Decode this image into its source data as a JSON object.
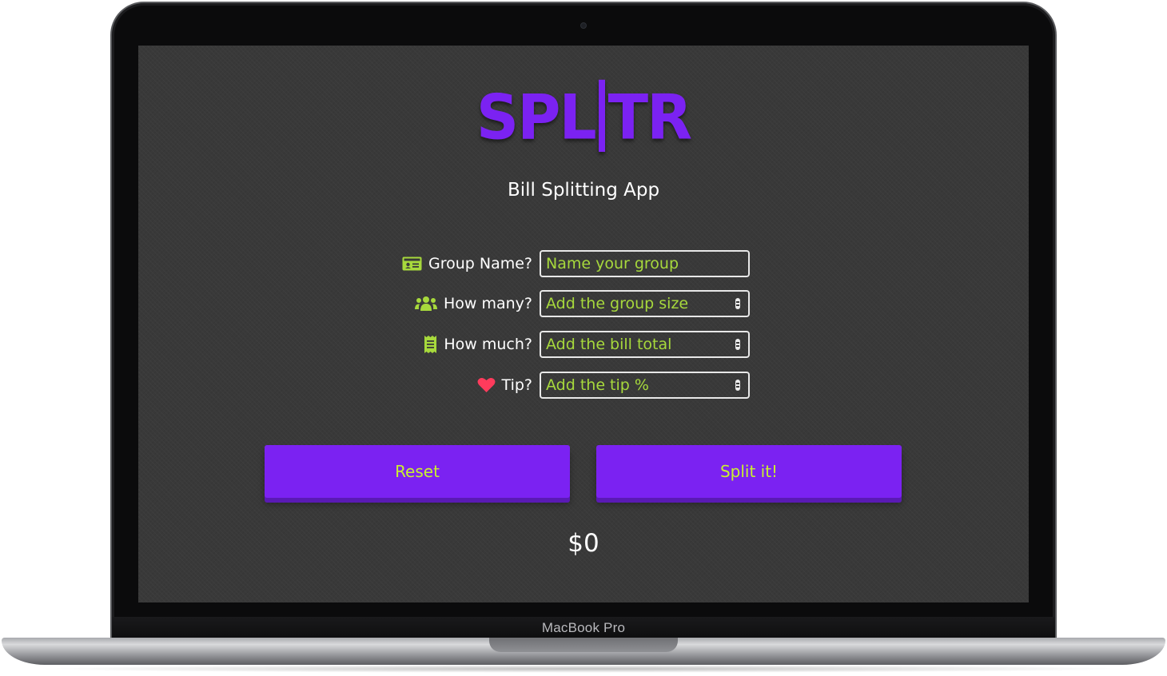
{
  "device": {
    "label": "MacBook Pro"
  },
  "app": {
    "logo_left": "SPL",
    "logo_right": "TR",
    "subtitle": "Bill Splitting App"
  },
  "form": {
    "group_name": {
      "label": "Group Name?",
      "placeholder": "Name your group",
      "icon": "id-card-icon"
    },
    "group_size": {
      "label": "How many?",
      "placeholder": "Add the group size",
      "icon": "users-icon"
    },
    "bill_total": {
      "label": "How much?",
      "placeholder": "Add the bill total",
      "icon": "receipt-icon"
    },
    "tip": {
      "label": "Tip?",
      "placeholder": "Add the tip %",
      "icon": "heart-icon"
    }
  },
  "buttons": {
    "reset": "Reset",
    "split": "Split it!"
  },
  "result": {
    "amount": "$0"
  },
  "colors": {
    "brand": "#7b22f2",
    "accent": "#a7d93c",
    "button_text": "#c9f030",
    "heart": "#ff3b5c",
    "background": "#393939"
  }
}
